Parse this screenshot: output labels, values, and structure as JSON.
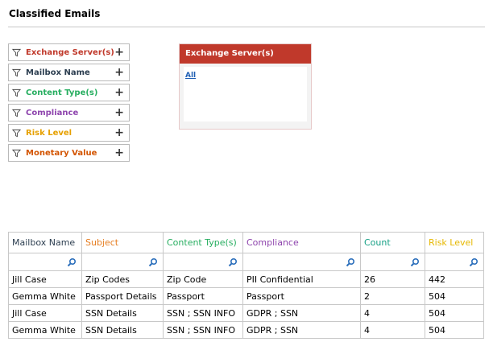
{
  "page": {
    "title": "Classified Emails"
  },
  "filters": [
    {
      "label": "Exchange Server(s)",
      "color": "#c0392b"
    },
    {
      "label": "Mailbox Name",
      "color": "#2c3e50"
    },
    {
      "label": "Content Type(s)",
      "color": "#27ae60"
    },
    {
      "label": "Compliance",
      "color": "#8e44ad"
    },
    {
      "label": "Risk Level",
      "color": "#e6a000"
    },
    {
      "label": "Monetary Value",
      "color": "#d35400"
    }
  ],
  "panel": {
    "title": "Exchange Server(s)",
    "link": "All",
    "accent": "#c0392b"
  },
  "table": {
    "columns": [
      {
        "label": "Mailbox Name",
        "color": "#2c3e50"
      },
      {
        "label": "Subject",
        "color": "#e67e22"
      },
      {
        "label": "Content Type(s)",
        "color": "#27ae60"
      },
      {
        "label": "Compliance",
        "color": "#8e44ad"
      },
      {
        "label": "Count",
        "color": "#16a085"
      },
      {
        "label": "Risk Level",
        "color": "#e6b800"
      }
    ],
    "rows": [
      [
        "Jill Case",
        "Zip Codes",
        "Zip Code",
        "PII Confidential",
        "26",
        "442"
      ],
      [
        "Gemma White",
        "Passport Details",
        "Passport",
        "Passport",
        "2",
        "504"
      ],
      [
        "Jill Case",
        "SSN Details",
        "SSN ; SSN INFO",
        "GDPR ; SSN",
        "4",
        "504"
      ],
      [
        "Gemma White",
        "SSN Details",
        "SSN ; SSN INFO",
        "GDPR ; SSN",
        "4",
        "504"
      ]
    ]
  },
  "icons": {
    "filter": "funnel-icon",
    "add": "plus-icon",
    "search": "magnifier-icon"
  }
}
